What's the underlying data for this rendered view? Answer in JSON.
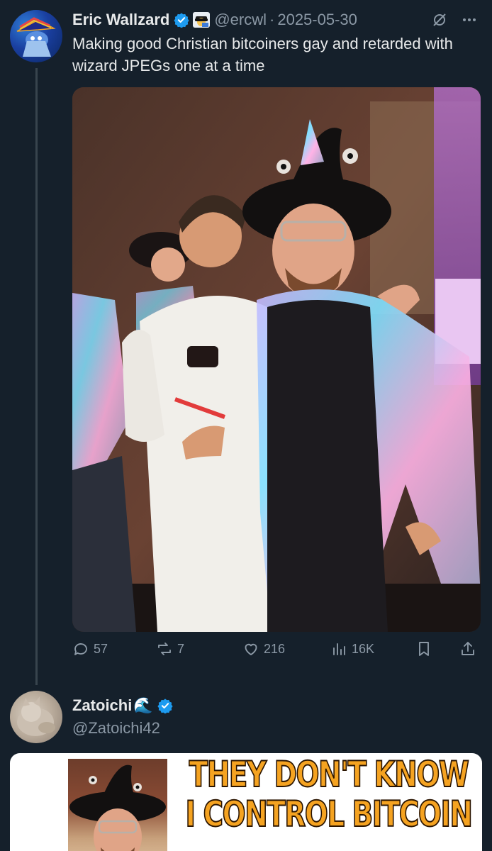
{
  "tweet": {
    "author_name": "Eric Wallzard",
    "handle": "@ercwl",
    "dot": "·",
    "date": "2025-05-30",
    "text": "Making good Christian bitcoiners gay and retarded with wizard JPEGs one at a time",
    "actions": {
      "replies": "57",
      "reposts": "7",
      "likes": "216",
      "views": "16K"
    }
  },
  "reply": {
    "author_name": "Zatoichi",
    "wave": "🌊",
    "handle": "@Zatoichi42",
    "meme_caption_line1": "THEY DON'T KNOW",
    "meme_caption_line2": "I CONTROL BITCOIN"
  },
  "colors": {
    "background": "#15202b",
    "verified": "#1d9bf0",
    "muted": "#8b98a5",
    "meme_text": "#f5a321"
  },
  "icons": [
    "verified-badge-icon",
    "grok-icon",
    "more-icon",
    "reply-icon",
    "repost-icon",
    "like-icon",
    "views-icon",
    "bookmark-icon",
    "share-icon"
  ]
}
